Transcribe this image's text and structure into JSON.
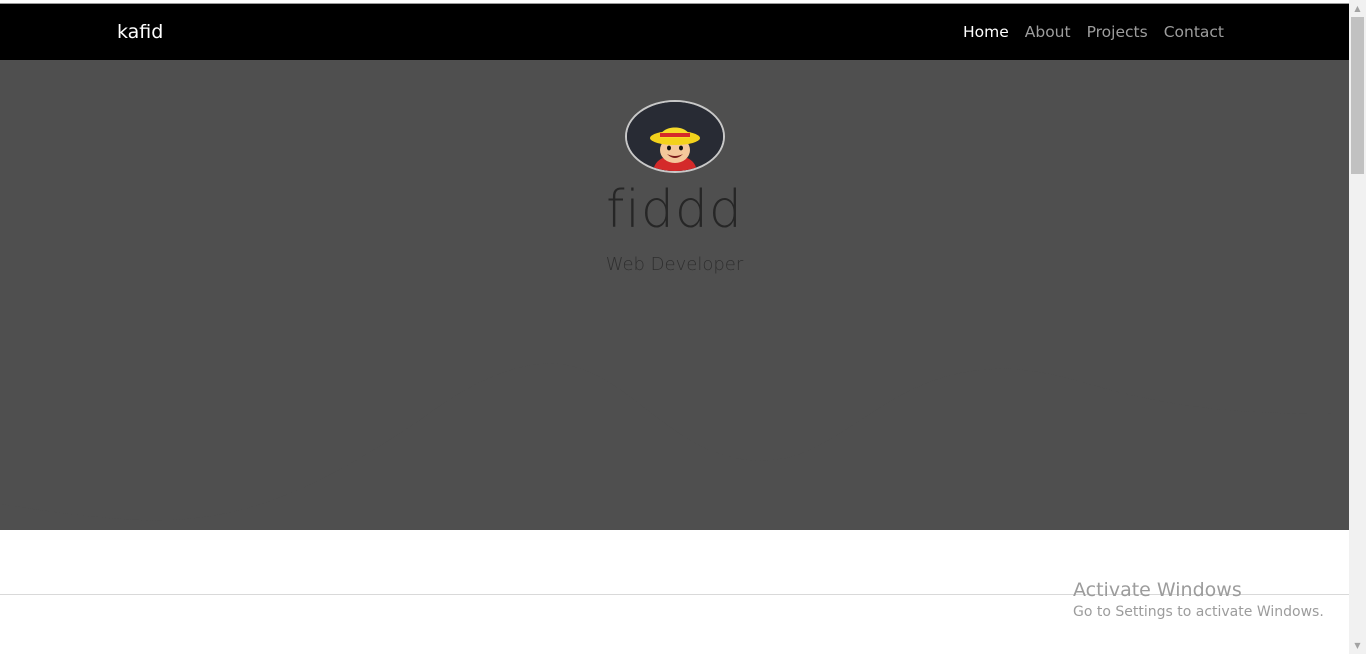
{
  "navbar": {
    "brand": "kafid",
    "links": [
      {
        "label": "Home",
        "active": true
      },
      {
        "label": "About",
        "active": false
      },
      {
        "label": "Projects",
        "active": false
      },
      {
        "label": "Contact",
        "active": false
      }
    ]
  },
  "hero": {
    "name": "fiddd",
    "role": "Web Developer",
    "avatar_icon": "straw-hat-character-avatar",
    "background_color": "#4f4f4f"
  },
  "watermark": {
    "title": "Activate Windows",
    "subtitle": "Go to Settings to activate Windows."
  },
  "scrollbar": {
    "up_icon": "scroll-up-arrow-icon",
    "down_icon": "scroll-down-arrow-icon"
  }
}
